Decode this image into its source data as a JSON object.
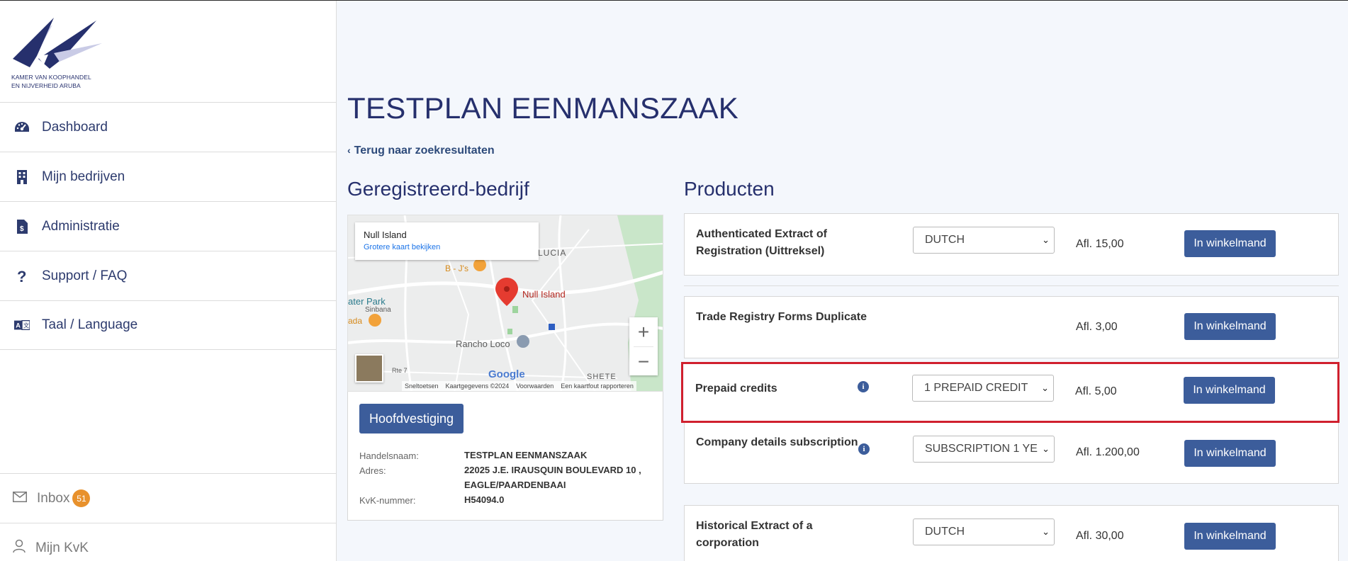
{
  "brand": {
    "line1": "KAMER VAN KOOPHANDEL",
    "line2": "EN NIJVERHEID ARUBA",
    "accent_color": "#26306d"
  },
  "sidebar": {
    "items": [
      {
        "label": "Dashboard",
        "icon": "speedometer-icon"
      },
      {
        "label": "Mijn bedrijven",
        "icon": "building-icon"
      },
      {
        "label": "Administratie",
        "icon": "invoice-icon"
      },
      {
        "label": "Support / FAQ",
        "icon": "question-icon"
      },
      {
        "label": "Taal / Language",
        "icon": "language-icon"
      }
    ],
    "inbox": {
      "label": "Inbox",
      "count": "51",
      "icon": "envelope-icon"
    },
    "account": {
      "label": "Mijn KvK",
      "icon": "user-icon"
    }
  },
  "main": {
    "title": "TESTPLAN EENMANSZAAK",
    "back_link": "Terug naar zoekresultaten",
    "registered_heading": "Geregistreerd-bedrijf",
    "products_heading": "Producten"
  },
  "map": {
    "place_name": "Null Island",
    "bigger_map_link": "Grotere kaart bekijken",
    "pin_label": "Null Island",
    "labels": [
      "LUCIA",
      "B - J's",
      "ater Park",
      "Sinbana",
      "ada",
      "Rancho Loco",
      "Rte 7",
      "SHETE"
    ],
    "footer": [
      "Sneltoetsen",
      "Kaartgegevens ©2024",
      "Voorwaarden",
      "Een kaartfout rapporteren"
    ],
    "logo_text": "Google",
    "zoom_in": "+",
    "zoom_out": "−"
  },
  "company": {
    "badge": "Hoofdvestiging",
    "fields": [
      {
        "label": "Handelsnaam:",
        "value": "TESTPLAN EENMANSZAAK"
      },
      {
        "label": "Adres:",
        "value": "22025 J.E. IRAUSQUIN BOULEVARD 10 , EAGLE/PAARDENBAAI"
      },
      {
        "label": "KvK-nummer:",
        "value": "H54094.0"
      }
    ]
  },
  "products": [
    {
      "name": "Authenticated Extract of Registration (Uittreksel)",
      "info": false,
      "selected": "DUTCH",
      "price": "Afl. 15,00",
      "button": "In winkelmand"
    },
    {
      "name": "Trade Registry Forms Duplicate",
      "info": false,
      "selected": "",
      "price": "Afl. 3,00",
      "button": "In winkelmand"
    },
    {
      "name": "Prepaid credits",
      "info": true,
      "selected": "1 PREPAID CREDIT",
      "price": "Afl. 5,00",
      "button": "In winkelmand"
    },
    {
      "name": "Company details subscription",
      "info": true,
      "selected": "SUBSCRIPTION 1 YE",
      "price": "Afl. 1.200,00",
      "button": "In winkelmand"
    },
    {
      "name": "Historical Extract of a corporation",
      "info": false,
      "selected": "DUTCH",
      "price": "Afl. 30,00",
      "button": "In winkelmand"
    }
  ],
  "colors": {
    "primary_button": "#3c5d9b",
    "highlight_border": "#d0202e",
    "badge": "#e8912c"
  }
}
